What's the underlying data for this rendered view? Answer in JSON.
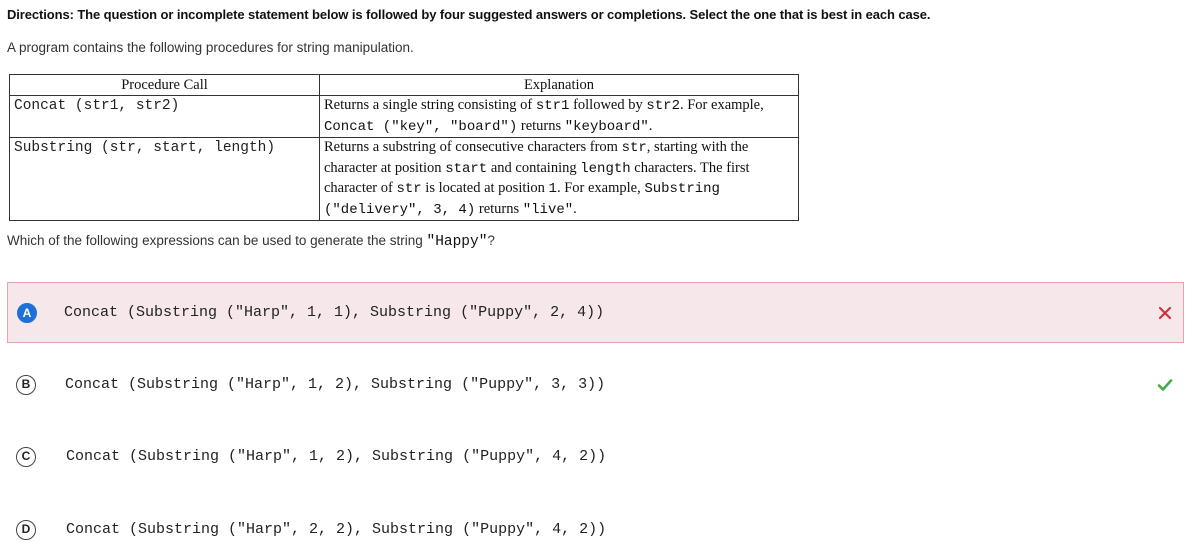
{
  "directions": "Directions: The question or incomplete statement below is followed by four suggested answers or completions. Select the one that is best in each case.",
  "intro": "A program contains the following procedures for string manipulation.",
  "table": {
    "headers": [
      "Procedure Call",
      "Explanation"
    ],
    "rows": [
      {
        "call": "Concat (str1, str2)",
        "expl": {
          "t1": "Returns a single string consisting of ",
          "c1": "str1",
          "t2": " followed by ",
          "c2": "str2",
          "t3": ". For example, ",
          "c3": "Concat (\"key\", \"board\")",
          "t4": " returns ",
          "c4": "\"keyboard\"",
          "t5": "."
        }
      },
      {
        "call": "Substring (str, start, length)",
        "expl": {
          "t1": "Returns a substring of consecutive characters from ",
          "c1": "str",
          "t2": ", starting with the character at position ",
          "c2": "start",
          "t3": " and containing ",
          "c3": "length",
          "t4": " characters. The first character of ",
          "c4": "str",
          "t5": " is located at position ",
          "c5": "1",
          "t6": ". For example, ",
          "c6": "Substring (\"delivery\", 3, 4)",
          "t7": " returns ",
          "c7": "\"live\"",
          "t8": "."
        }
      }
    ]
  },
  "question": {
    "prefix": "Which of the following expressions can be used to generate the string ",
    "code": "\"Happy\"",
    "suffix": "?"
  },
  "choices": [
    {
      "letter": "A",
      "code": "Concat (Substring (\"Harp\", 1, 1), Substring (\"Puppy\", 2, 4))",
      "status": "incorrect",
      "selected": true
    },
    {
      "letter": "B",
      "code": "Concat (Substring (\"Harp\", 1, 2), Substring (\"Puppy\", 3, 3))",
      "status": "correct",
      "selected": false
    },
    {
      "letter": "C",
      "code": "Concat (Substring (\"Harp\", 1, 2), Substring (\"Puppy\", 4, 2))",
      "status": "none",
      "selected": false
    },
    {
      "letter": "D",
      "code": "Concat (Substring (\"Harp\", 2, 2), Substring (\"Puppy\", 4, 2))",
      "status": "none",
      "selected": false
    }
  ],
  "colors": {
    "selected_badge": "#1f6fd6",
    "incorrect_mark": "#d0323f",
    "correct_mark": "#3fae49",
    "incorrect_bg": "#f6e8ea"
  },
  "icons": {
    "incorrect": "x-icon",
    "correct": "check-icon"
  }
}
